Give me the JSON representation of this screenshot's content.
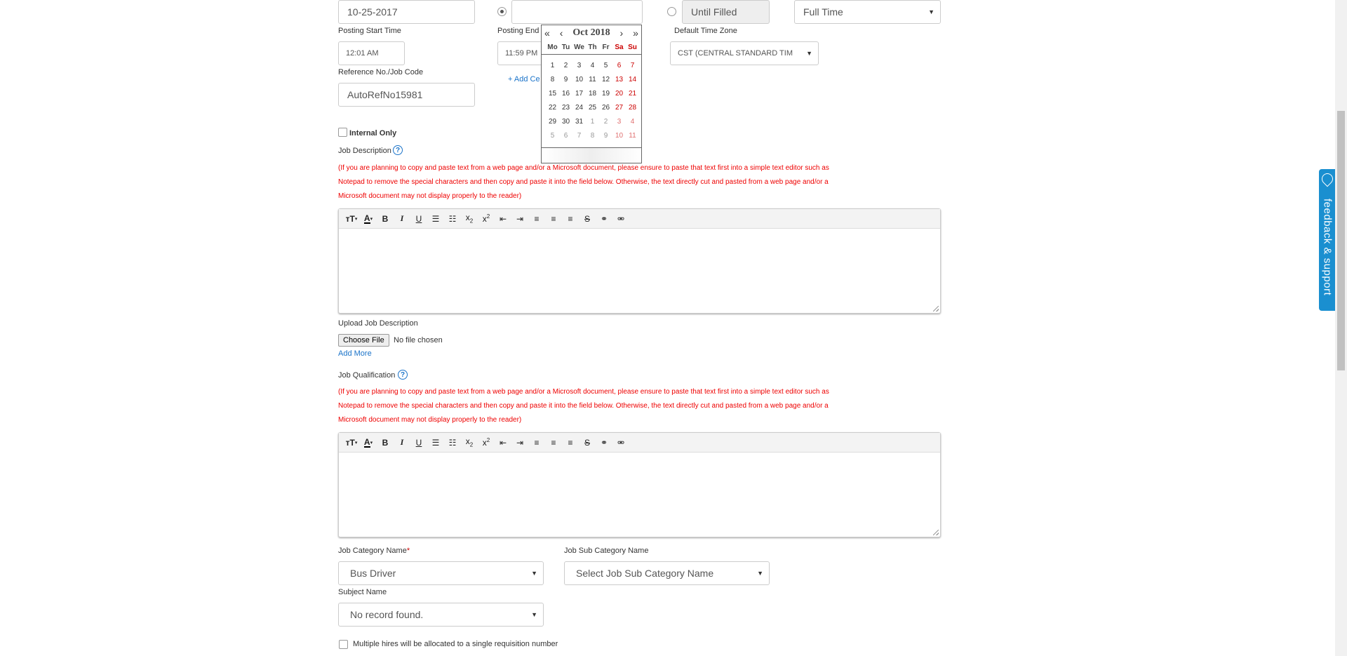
{
  "top_row": {
    "start_date_value": "10-25-2017",
    "end_date_value": "",
    "until_filled_value": "Until Filled",
    "job_type_value": "Full Time"
  },
  "posting_start_time": {
    "label": "Posting Start Time",
    "value": "12:01 AM"
  },
  "posting_end_time": {
    "label": "Posting End",
    "value": "11:59 PM"
  },
  "add_link": "+ Add Ce",
  "default_time_zone": {
    "label": "Default Time Zone",
    "value": "CST (CENTRAL STANDARD TIM"
  },
  "reference": {
    "label": "Reference No./Job Code",
    "value": "AutoRefNo15981"
  },
  "internal_only": {
    "label": "Internal Only",
    "checked": false
  },
  "job_description": {
    "label": "Job Description",
    "warning_lines": [
      "(If you are planning to copy and paste text from a web page and/or a Microsoft document, please ensure to paste that text first into a simple text editor such as",
      "Notepad to remove the special characters and then copy and paste it into the field below. Otherwise, the text directly cut and pasted from a web page and/or a",
      "Microsoft document may not display properly to the reader)"
    ]
  },
  "upload": {
    "label": "Upload Job Description",
    "button": "Choose File",
    "status": "No file chosen",
    "add_more": "Add More"
  },
  "job_qualification": {
    "label": "Job Qualification",
    "warning_lines": [
      "(If you are planning to copy and paste text from a web page and/or a Microsoft document, please ensure to paste that text first into a simple text editor such as",
      "Notepad to remove the special characters and then copy and paste it into the field below. Otherwise, the text directly cut and pasted from a web page and/or a",
      "Microsoft document may not display properly to the reader)"
    ]
  },
  "job_category": {
    "label": "Job Category Name",
    "required_mark": "*",
    "value": "Bus Driver"
  },
  "job_sub_category": {
    "label": "Job Sub Category Name",
    "value": "Select Job Sub Category Name"
  },
  "subject": {
    "label": "Subject Name",
    "value": "No record found."
  },
  "multiple_hires": {
    "label": "Multiple hires will be allocated to a single requisition number",
    "checked": false
  },
  "datepicker": {
    "title": "Oct 2018",
    "prev_year": "«",
    "prev_month": "‹",
    "next_month": "›",
    "next_year": "»",
    "weekdays": [
      "Mo",
      "Tu",
      "We",
      "Th",
      "Fr",
      "Sa",
      "Su"
    ],
    "weeks": [
      [
        "1",
        "2",
        "3",
        "4",
        "5",
        "6",
        "7"
      ],
      [
        "8",
        "9",
        "10",
        "11",
        "12",
        "13",
        "14"
      ],
      [
        "15",
        "16",
        "17",
        "18",
        "19",
        "20",
        "21"
      ],
      [
        "22",
        "23",
        "24",
        "25",
        "26",
        "27",
        "28"
      ],
      [
        "29",
        "30",
        "31",
        "1",
        "2",
        "3",
        "4"
      ],
      [
        "5",
        "6",
        "7",
        "8",
        "9",
        "10",
        "11"
      ]
    ],
    "other_month_from_index": 31
  },
  "feedback": {
    "label": "feedback & support"
  },
  "toolbar_icons": [
    "font-size-icon",
    "font-color-icon",
    "bold-icon",
    "italic-icon",
    "underline-icon",
    "ordered-list-icon",
    "unordered-list-icon",
    "subscript-icon",
    "superscript-icon",
    "outdent-icon",
    "indent-icon",
    "align-left-icon",
    "align-center-icon",
    "align-right-icon",
    "strikethrough-icon",
    "link-icon",
    "unlink-icon"
  ],
  "colors": {
    "accent": "#1a73c9",
    "warning": "#ee0000",
    "feedback_tab": "#1a8fd0",
    "weekend": "#cc0000"
  }
}
